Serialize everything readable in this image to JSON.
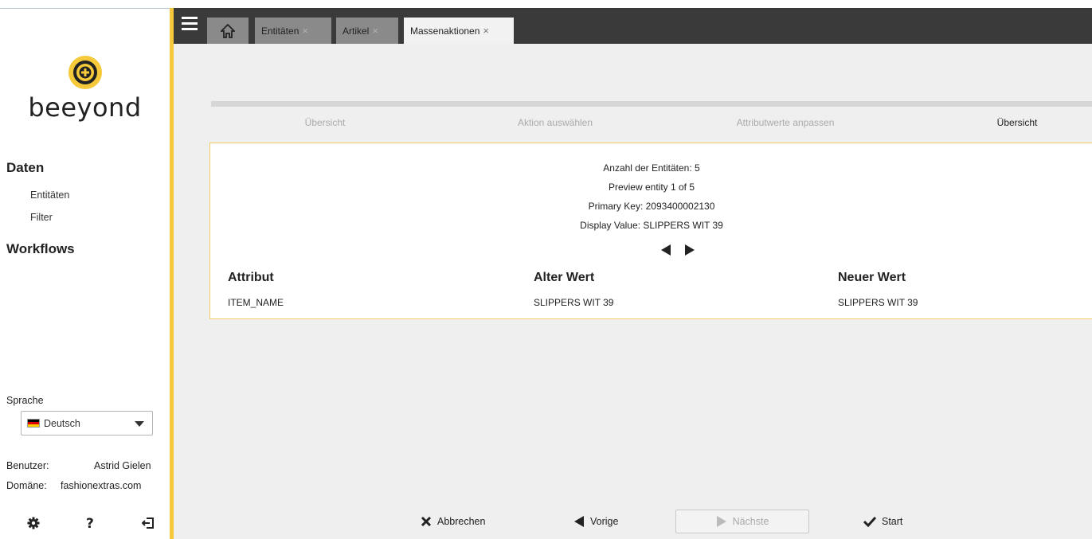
{
  "sidebar": {
    "brand": "beeyond",
    "sections": [
      {
        "title": "Daten",
        "items": [
          "Entitäten",
          "Filter"
        ]
      },
      {
        "title": "Workflows",
        "items": []
      }
    ],
    "language": {
      "label": "Sprache",
      "selected": "Deutsch"
    },
    "user": {
      "user_label": "Benutzer:",
      "user_value": "Astrid Gielen",
      "domain_label": "Domäne:",
      "domain_value": "fashionextras.com"
    },
    "icons": [
      "gear-icon",
      "help-icon",
      "logout-icon"
    ]
  },
  "topbar": {
    "tabs": [
      {
        "label": "Entitäten",
        "close": "×"
      },
      {
        "label": "Artikel",
        "close": "×"
      },
      {
        "label": "Massenaktionen",
        "close": "×",
        "active": true
      }
    ]
  },
  "wizard": {
    "steps": [
      "Übersicht",
      "Aktion auswählen",
      "Attributwerte anpassen",
      "Übersicht"
    ],
    "current_step": 4
  },
  "preview": {
    "count_label": "Anzahl der Entitäten:",
    "count_value": "5",
    "preview_text": "Preview entity 1 of 5",
    "pk_label": "Primary Key:",
    "pk_value": "2093400002130",
    "display_label": "Display Value:",
    "display_value": "SLIPPERS WIT 39",
    "columns": [
      "Attribut",
      "Alter Wert",
      "Neuer Wert"
    ],
    "rows": [
      [
        "ITEM_NAME",
        "SLIPPERS WIT 39",
        "SLIPPERS WIT 39"
      ]
    ]
  },
  "footer": {
    "cancel": "Abbrechen",
    "prev": "Vorige",
    "next": "Nächste",
    "start": "Start"
  },
  "colors": {
    "accent": "#f6c93a",
    "topbar": "#3a3a3a",
    "tab_inactive": "#8a8a8a",
    "background": "#efefef"
  }
}
